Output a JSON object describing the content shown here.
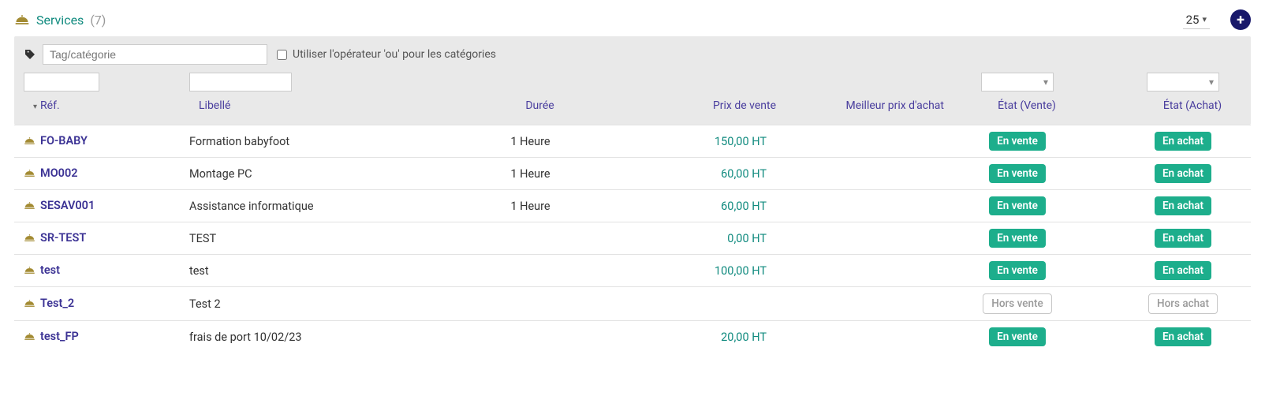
{
  "header": {
    "title": "Services",
    "count": "(7)",
    "page_size": "25"
  },
  "filter": {
    "tag_placeholder": "Tag/catégorie",
    "or_label": "Utiliser l'opérateur 'ou' pour les catégories"
  },
  "columns": {
    "ref": "Réf.",
    "libelle": "Libellé",
    "duree": "Durée",
    "prix_vente": "Prix de vente",
    "prix_achat": "Meilleur prix d'achat",
    "etat_vente": "État (Vente)",
    "etat_achat": "État (Achat)"
  },
  "badges": {
    "en_vente": "En vente",
    "en_achat": "En achat",
    "hors_vente": "Hors vente",
    "hors_achat": "Hors achat"
  },
  "rows": [
    {
      "ref": "FO-BABY",
      "libelle": "Formation babyfoot",
      "duree": "1 Heure",
      "prix": "150,00 HT",
      "vente": "en_vente",
      "achat": "en_achat"
    },
    {
      "ref": "MO002",
      "libelle": "Montage PC",
      "duree": "1 Heure",
      "prix": "60,00 HT",
      "vente": "en_vente",
      "achat": "en_achat"
    },
    {
      "ref": "SESAV001",
      "libelle": "Assistance informatique",
      "duree": "1 Heure",
      "prix": "60,00 HT",
      "vente": "en_vente",
      "achat": "en_achat"
    },
    {
      "ref": "SR-TEST",
      "libelle": "TEST",
      "duree": "",
      "prix": "0,00 HT",
      "vente": "en_vente",
      "achat": "en_achat"
    },
    {
      "ref": "test",
      "libelle": "test",
      "duree": "",
      "prix": "100,00 HT",
      "vente": "en_vente",
      "achat": "en_achat"
    },
    {
      "ref": "Test_2",
      "libelle": "Test 2",
      "duree": "",
      "prix": "",
      "vente": "hors_vente",
      "achat": "hors_achat"
    },
    {
      "ref": "test_FP",
      "libelle": "frais de port 10/02/23",
      "duree": "",
      "prix": "20,00 HT",
      "vente": "en_vente",
      "achat": "en_achat"
    }
  ]
}
